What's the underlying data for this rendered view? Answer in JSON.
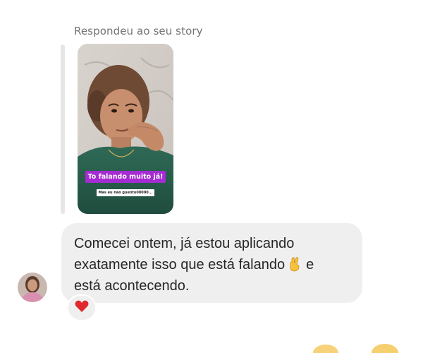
{
  "story_reply": {
    "caption": "Respondeu ao seu story",
    "story_text": "To falando muito já!",
    "story_subtext": "Mas eu não guento00000..."
  },
  "message": {
    "line1": "Comecei ontem, já estou aplicando",
    "line2_before_emoji": "exatamente isso que está falando",
    "line2_after_emoji": "e",
    "line3": "está acontecendo.",
    "inline_emoji": "crossed-fingers-icon"
  },
  "reaction": {
    "emoji": "heart-icon",
    "color": "#e0292e"
  },
  "colors": {
    "bubble": "#efefef",
    "caption": "#737373",
    "text": "#262626",
    "story_label": "#a52bd3"
  }
}
